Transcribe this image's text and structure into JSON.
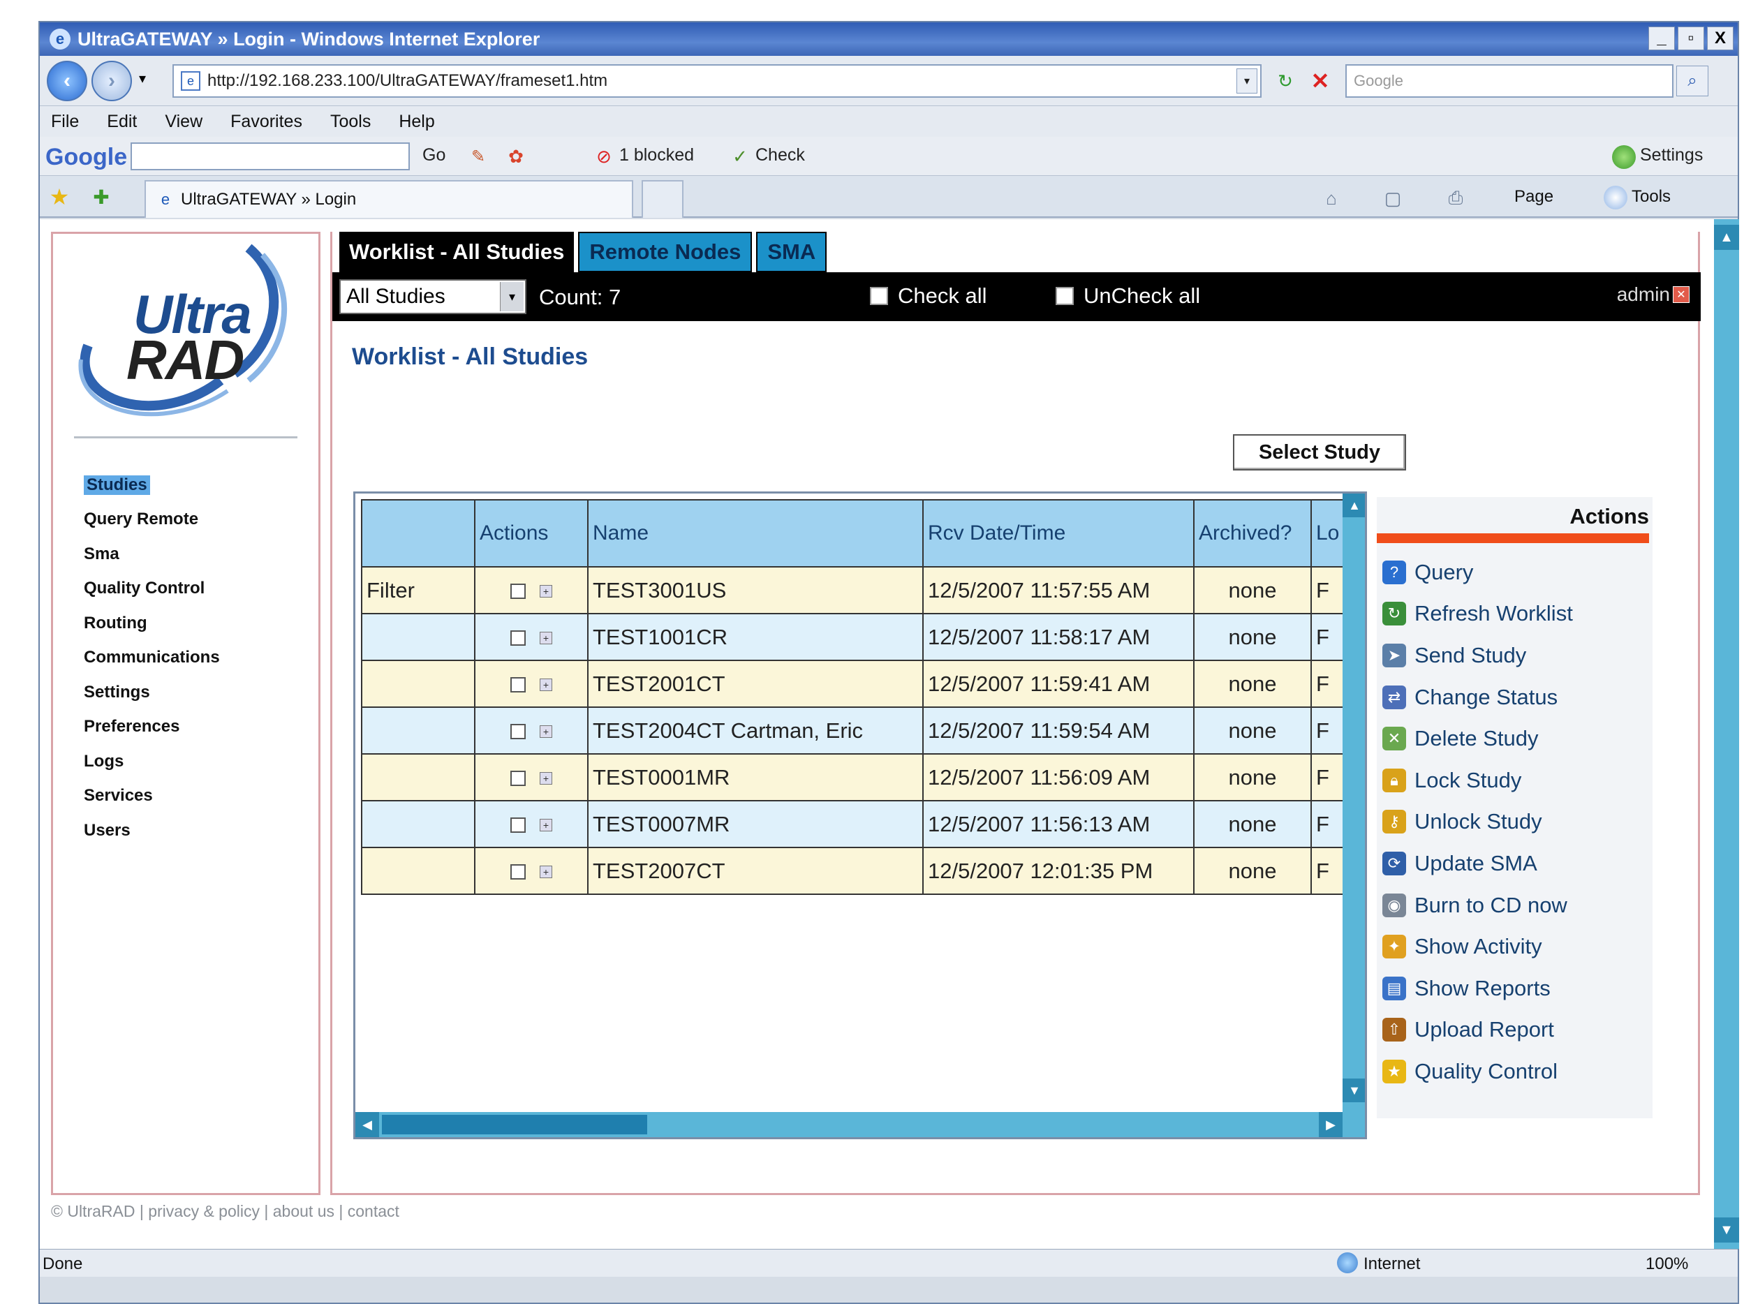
{
  "window": {
    "title": "UltraGATEWAY » Login - Windows Internet Explorer",
    "controls": [
      "_",
      "▫",
      "X"
    ]
  },
  "address": {
    "url": "http://192.168.233.100/UltraGATEWAY/frameset1.htm",
    "search_placeholder": "Google"
  },
  "menu": [
    "File",
    "Edit",
    "View",
    "Favorites",
    "Tools",
    "Help"
  ],
  "google_toolbar": {
    "logo": "Google",
    "go": "Go",
    "blocked": "1 blocked",
    "check": "Check",
    "settings": "Settings"
  },
  "browser_tab": {
    "label": "UltraGATEWAY » Login",
    "commands": [
      "Page",
      "Tools"
    ]
  },
  "brand": {
    "line1": "Ultra",
    "line2": "RAD"
  },
  "sidebar": {
    "items": [
      {
        "label": "Studies",
        "selected": true
      },
      {
        "label": "Query Remote"
      },
      {
        "label": "Sma"
      },
      {
        "label": "Quality Control"
      },
      {
        "label": "Routing"
      },
      {
        "label": "Communications"
      },
      {
        "label": "Settings"
      },
      {
        "label": "Preferences"
      },
      {
        "label": "Logs"
      },
      {
        "label": "Services"
      },
      {
        "label": "Users"
      }
    ]
  },
  "tabs": {
    "worklist": "Worklist - All Studies",
    "remote": "Remote Nodes",
    "sma": "SMA"
  },
  "toolbar": {
    "filter_select": "All Studies",
    "count": "Count: 7",
    "check_all": "Check all",
    "uncheck_all": "UnCheck all",
    "user": "admin"
  },
  "main": {
    "heading": "Worklist - All Studies",
    "select_study": "Select Study"
  },
  "grid": {
    "columns": [
      "",
      "Actions",
      "Name",
      "Rcv Date/Time",
      "Archived?",
      "Lo"
    ],
    "filter_label": "Filter",
    "rows": [
      {
        "name": "TEST3001US",
        "date": "12/5/2007 11:57:55 AM",
        "archived": "none",
        "lo": "F"
      },
      {
        "name": "TEST1001CR",
        "date": "12/5/2007 11:58:17 AM",
        "archived": "none",
        "lo": "F"
      },
      {
        "name": "TEST2001CT",
        "date": "12/5/2007 11:59:41 AM",
        "archived": "none",
        "lo": "F"
      },
      {
        "name": "TEST2004CT Cartman, Eric",
        "date": "12/5/2007 11:59:54 AM",
        "archived": "none",
        "lo": "F"
      },
      {
        "name": "TEST0001MR",
        "date": "12/5/2007 11:56:09 AM",
        "archived": "none",
        "lo": "F"
      },
      {
        "name": "TEST0007MR",
        "date": "12/5/2007 11:56:13 AM",
        "archived": "none",
        "lo": "F"
      },
      {
        "name": "TEST2007CT",
        "date": "12/5/2007 12:01:35 PM",
        "archived": "none",
        "lo": "F"
      }
    ]
  },
  "actions": {
    "title": "Actions",
    "items": [
      {
        "label": "Query",
        "icon": "query-icon",
        "color": "#2a6fd0"
      },
      {
        "label": "Refresh Worklist",
        "icon": "refresh-icon",
        "color": "#3a8f3a"
      },
      {
        "label": "Send Study",
        "icon": "send-icon",
        "color": "#5b7fa8"
      },
      {
        "label": "Change Status",
        "icon": "status-icon",
        "color": "#4d6fb8"
      },
      {
        "label": "Delete Study",
        "icon": "delete-icon",
        "color": "#6aa84f"
      },
      {
        "label": "Lock Study",
        "icon": "lock-icon",
        "color": "#d9a21a"
      },
      {
        "label": "Unlock Study",
        "icon": "unlock-icon",
        "color": "#d9a21a"
      },
      {
        "label": "Update SMA",
        "icon": "update-icon",
        "color": "#2f5fa8"
      },
      {
        "label": "Burn to CD now",
        "icon": "cd-icon",
        "color": "#7a8696"
      },
      {
        "label": "Show Activity",
        "icon": "activity-icon",
        "color": "#e0a020"
      },
      {
        "label": "Show Reports",
        "icon": "reports-icon",
        "color": "#3a72c8"
      },
      {
        "label": "Upload Report",
        "icon": "upload-icon",
        "color": "#a8631a"
      },
      {
        "label": "Quality Control",
        "icon": "star-icon",
        "color": "#e8b714"
      }
    ]
  },
  "footer": "© UltraRAD | privacy & policy | about us | contact",
  "status": {
    "left": "Done",
    "zone": "Internet",
    "zoom": "100%"
  }
}
